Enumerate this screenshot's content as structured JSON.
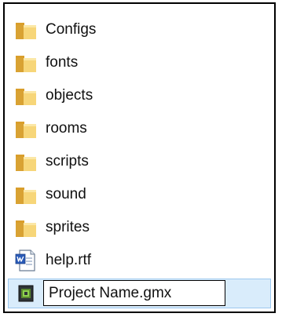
{
  "file_list": {
    "items": [
      {
        "name": "Configs",
        "icon": "folder-icon"
      },
      {
        "name": "fonts",
        "icon": "folder-icon"
      },
      {
        "name": "objects",
        "icon": "folder-icon"
      },
      {
        "name": "rooms",
        "icon": "folder-icon"
      },
      {
        "name": "scripts",
        "icon": "folder-icon"
      },
      {
        "name": "sound",
        "icon": "folder-icon"
      },
      {
        "name": "sprites",
        "icon": "folder-icon"
      },
      {
        "name": "help.rtf",
        "icon": "word-document-icon"
      }
    ],
    "rename_item": {
      "icon": "gamemaker-project-icon",
      "value": "Project Name.gmx"
    }
  },
  "colors": {
    "folder": "#e8b94a",
    "selection": "#d9ecfb",
    "border": "#000000"
  }
}
